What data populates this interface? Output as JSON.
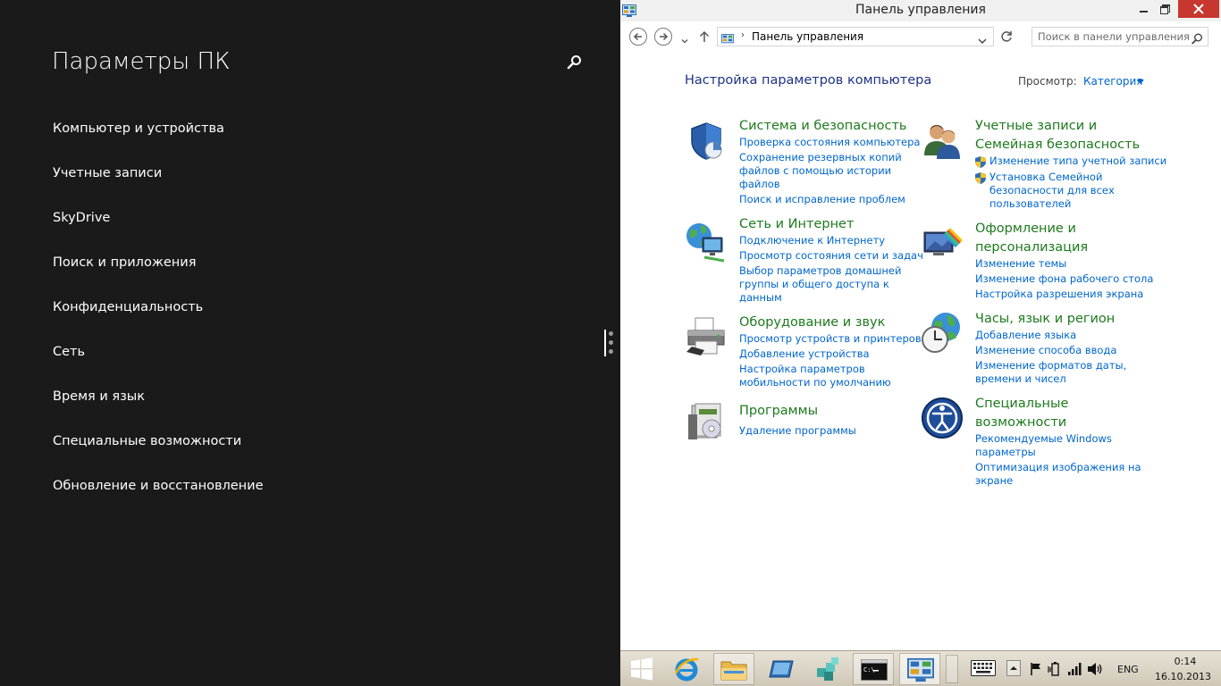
{
  "pc_settings": {
    "title": "Параметры ПК",
    "search_icon": "search-icon",
    "items": [
      {
        "label": "Компьютер и устройства"
      },
      {
        "label": "Учетные записи"
      },
      {
        "label": "SkyDrive"
      },
      {
        "label": "Поиск и приложения"
      },
      {
        "label": "Конфиденциальность"
      },
      {
        "label": "Сеть"
      },
      {
        "label": "Время и язык"
      },
      {
        "label": "Специальные возможности"
      },
      {
        "label": "Обновление и восстановление"
      }
    ]
  },
  "window": {
    "title": "Панель управления",
    "address": "Панель управления",
    "search_placeholder": "Поиск в панели управления"
  },
  "control_panel": {
    "heading": "Настройка параметров компьютера",
    "view_label": "Просмотр:",
    "view_value": "Категория",
    "categories": [
      {
        "icon": "shield-icon",
        "title_lines": [
          "Система и безопасность"
        ],
        "links": [
          [
            "Проверка состояния компьютера"
          ],
          [
            "Сохранение резервных копий",
            "файлов с помощью истории",
            "файлов"
          ],
          [
            "Поиск и исправление проблем"
          ]
        ]
      },
      {
        "icon": "users-icon",
        "title_lines": [
          "Учетные записи и",
          "Семейная безопасность"
        ],
        "links": [
          [
            "Изменение типа учетной записи"
          ],
          [
            "Установка Семейной",
            "безопасности для всех",
            "пользователей"
          ]
        ]
      },
      {
        "icon": "network-globe-icon",
        "title_lines": [
          "Сеть и Интернет"
        ],
        "links": [
          [
            "Подключение к Интернету"
          ],
          [
            "Просмотр состояния сети и задач"
          ],
          [
            "Выбор параметров домашней",
            "группы и общего доступа к",
            "данным"
          ]
        ]
      },
      {
        "icon": "personalization-icon",
        "title_lines": [
          "Оформление и",
          "персонализация"
        ],
        "links": [
          [
            "Изменение темы"
          ],
          [
            "Изменение фона рабочего стола"
          ],
          [
            "Настройка разрешения экрана"
          ]
        ]
      },
      {
        "icon": "printer-icon",
        "title_lines": [
          "Оборудование и звук"
        ],
        "links": [
          [
            "Просмотр устройств и принтеров"
          ],
          [
            "Добавление устройства"
          ],
          [
            "Настройка параметров",
            "мобильности по умолчанию"
          ]
        ]
      },
      {
        "icon": "clock-globe-icon",
        "title_lines": [
          "Часы, язык и регион"
        ],
        "links": [
          [
            "Добавление языка"
          ],
          [
            "Изменение способа ввода"
          ],
          [
            "Изменение форматов даты,",
            "времени и чисел"
          ]
        ]
      },
      {
        "icon": "programs-icon",
        "title_lines": [
          "Программы"
        ],
        "links": [
          [
            "Удаление программы"
          ]
        ]
      },
      {
        "icon": "ease-of-access-icon",
        "title_lines": [
          "Специальные",
          "возможности"
        ],
        "links": [
          [
            "Рекомендуемые Windows",
            "параметры"
          ],
          [
            "Оптимизация изображения на",
            "экране"
          ]
        ]
      }
    ]
  },
  "taskbar": {
    "apps": [
      {
        "name": "start",
        "icon": "windows-logo-icon"
      },
      {
        "name": "internet-explorer",
        "icon": "ie-icon"
      },
      {
        "name": "file-explorer",
        "icon": "folder-icon"
      },
      {
        "name": "remote-desktop",
        "icon": "rdp-icon"
      },
      {
        "name": "app",
        "icon": "cubes-icon"
      },
      {
        "name": "command-prompt",
        "icon": "cmd-icon"
      },
      {
        "name": "control-panel",
        "icon": "control-panel-icon"
      }
    ],
    "language": "ENG",
    "time": "0:14",
    "date": "16.10.2013"
  },
  "colors": {
    "pc_settings_bg": "#1a1a1a",
    "link": "#0066cc",
    "category_title": "#1e7a1e",
    "heading": "#1e3287",
    "close_button": "#c7372f"
  }
}
